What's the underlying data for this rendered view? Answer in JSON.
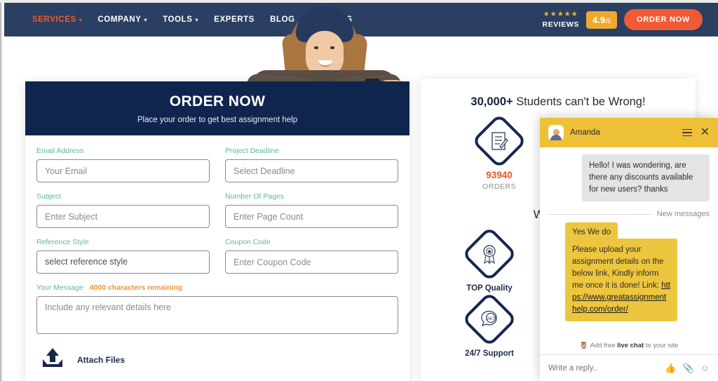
{
  "navbar": {
    "links": [
      {
        "label": "SERVICES",
        "caret": true,
        "active": true
      },
      {
        "label": "COMPANY",
        "caret": true,
        "active": false
      },
      {
        "label": "TOOLS",
        "caret": true,
        "active": false
      },
      {
        "label": "EXPERTS",
        "caret": false,
        "active": false
      },
      {
        "label": "BLOG",
        "caret": false,
        "active": false
      },
      {
        "label": "SAMPLES",
        "caret": false,
        "active": false
      }
    ],
    "stars": "★★★★★",
    "reviews_label": "REVIEWS",
    "rating_value": "4.9",
    "rating_denom": "/5",
    "order_now_label": "ORDER NOW"
  },
  "order_card": {
    "title": "ORDER NOW",
    "subtitle": "Place your order to get best assignment help",
    "fields": {
      "email": {
        "label": "Email Address",
        "placeholder": "Your Email",
        "value": ""
      },
      "deadline": {
        "label": "Project Deadline",
        "placeholder": "Select Deadline",
        "value": ""
      },
      "subject": {
        "label": "Subject",
        "placeholder": "Enter Subject",
        "value": ""
      },
      "pages": {
        "label": "Number Of Pages",
        "placeholder": "Enter Page Count",
        "value": ""
      },
      "reference": {
        "label": "Reference Style",
        "value": "select reference style"
      },
      "coupon": {
        "label": "Coupon Code",
        "placeholder": "Enter Coupon Code",
        "value": ""
      },
      "message": {
        "label": "Your Message",
        "charcount": "4000 characters remaining",
        "placeholder": "Include any relevant details here",
        "value": ""
      }
    },
    "attach_label": "Attach Files"
  },
  "stats_card": {
    "headline_bold": "30,000+",
    "headline_rest": " Students can't be Wrong!",
    "stats": [
      {
        "icon": "order-document-icon",
        "number": "93940",
        "caption": "ORDERS"
      }
    ],
    "why_title": "Why stud",
    "features": [
      {
        "icon": "quality-ribbon-icon",
        "caption": "TOP Quality"
      },
      {
        "icon": "support-247-icon",
        "caption": "24/7 Support"
      }
    ]
  },
  "chat": {
    "agent_name": "Amanda",
    "messages": [
      {
        "from": "visitor",
        "text": "Hello! I was wondering, are there any discounts available for new users? thanks"
      },
      {
        "from": "agent",
        "text": "Yes We do"
      },
      {
        "from": "agent",
        "text": "Please upload your assignment details on the below link, Kindly inform me once it is done! Link: ",
        "link": "https://www.greatassignmenthelp.com/order/"
      }
    ],
    "new_messages_label": "New messages",
    "promo_prefix": "Add free ",
    "promo_bold": "live chat",
    "promo_suffix": " to your site",
    "reply_placeholder": "Write a reply..",
    "reply_value": "",
    "foot_icons": [
      "thumbs-up-icon",
      "attachment-icon",
      "emoji-icon"
    ]
  },
  "colors": {
    "navbar_navy": "#2a3f61",
    "panel_navy": "#10254e",
    "accent_orange": "#f05a34",
    "rating_gold": "#f0a92d",
    "chat_yellow": "#edc037",
    "label_green": "#5fb894",
    "stat_orange": "#e8552d"
  }
}
